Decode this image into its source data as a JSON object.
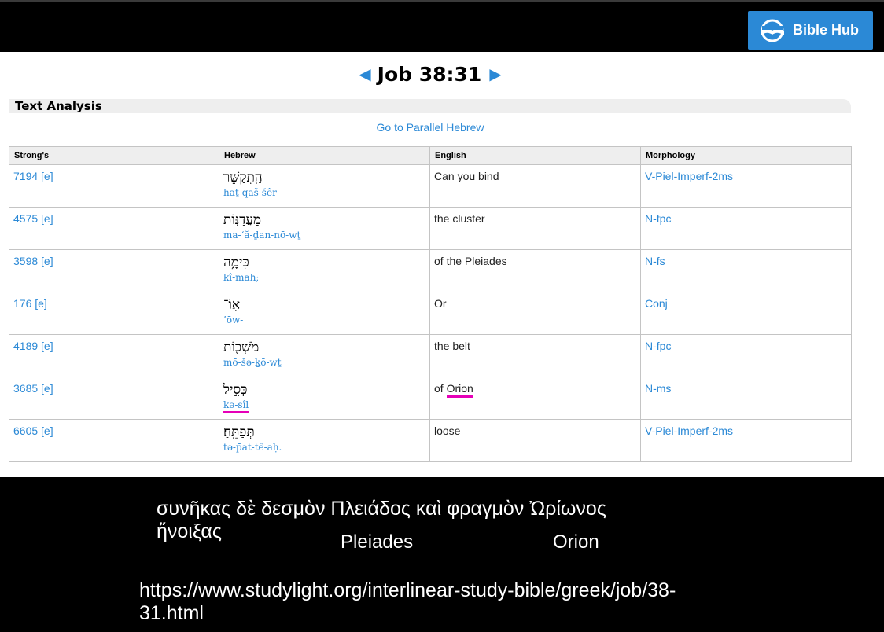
{
  "header": {
    "logo_text": "Bible Hub",
    "brand_color": "#2b89d6"
  },
  "nav": {
    "prev_icon": "◀",
    "next_icon": "▶",
    "reference": "Job 38:31"
  },
  "section_title": "Text Analysis",
  "parallel_link": "Go to Parallel Hebrew",
  "table": {
    "headers": [
      "Strong's",
      "Hebrew",
      "English",
      "Morphology"
    ],
    "rows": [
      {
        "strongs": "7194 [e]",
        "hebrew": "הַֽתְקַשֵּׁר",
        "translit": "haṯ-qaš-šêr",
        "english": "Can you bind",
        "morph": "V-Piel-Imperf-2ms"
      },
      {
        "strongs": "4575 [e]",
        "hebrew": "מַעֲדַנּ֣וֹת",
        "translit": "ma-‘ă-ḏan-nō-wṯ",
        "english": "the cluster",
        "morph": "N-fpc"
      },
      {
        "strongs": "3598 [e]",
        "hebrew": "כִּימָ֑ה",
        "translit": "kî-māh;",
        "english": "of the Pleiades",
        "morph": "N-fs"
      },
      {
        "strongs": "176 [e]",
        "hebrew": "אֽוֹ־",
        "translit": "’ōw-",
        "english": "Or",
        "morph": "Conj"
      },
      {
        "strongs": "4189 [e]",
        "hebrew": "מֹשְׁכ֖וֹת",
        "translit": "mō-šə-ḵō-wṯ",
        "english": "the belt",
        "morph": "N-fpc"
      },
      {
        "strongs": "3685 [e]",
        "hebrew": "כְּסִ֣יל",
        "translit": "kə-sîl",
        "english_prefix": "of ",
        "english_word": "Orion",
        "morph": "N-ms"
      },
      {
        "strongs": "6605 [e]",
        "hebrew": "תְּפַתֵּֽחַ׃",
        "translit": "tə-p̄at-tê-aḥ.",
        "english": "loose",
        "morph": "V-Piel-Imperf-2ms"
      }
    ]
  },
  "highlight_color": "#e600b8",
  "captions": {
    "greek_text": "συνῆκας δὲ δεσμὸν Πλειάδος καὶ φραγμὸν Ὠρίωνος ἤνοιξας",
    "word_pleiades": "Pleiades",
    "word_orion": "Orion",
    "url": "https://www.studylight.org/interlinear-study-bible/greek/job/38-31.html"
  }
}
